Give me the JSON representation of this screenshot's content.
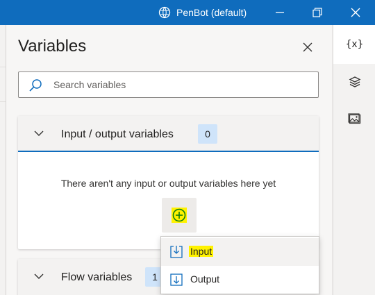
{
  "titlebar": {
    "bot_name": "PenBot (default)",
    "accent": "#0f6cbd"
  },
  "pane": {
    "title": "Variables",
    "search_placeholder": "Search variables"
  },
  "sections": [
    {
      "title": "Input / output variables",
      "count": "0",
      "empty_text": "There aren't any input or output variables here yet"
    },
    {
      "title": "Flow variables",
      "count": "1"
    }
  ],
  "add_menu": {
    "items": [
      {
        "label": "Input",
        "icon": "input-arrow-icon",
        "highlighted": true
      },
      {
        "label": "Output",
        "icon": "output-arrow-icon",
        "highlighted": false
      }
    ]
  },
  "rail": {
    "variables_label": "{x}",
    "items": [
      "variables-icon",
      "layers-icon",
      "image-icon"
    ]
  }
}
